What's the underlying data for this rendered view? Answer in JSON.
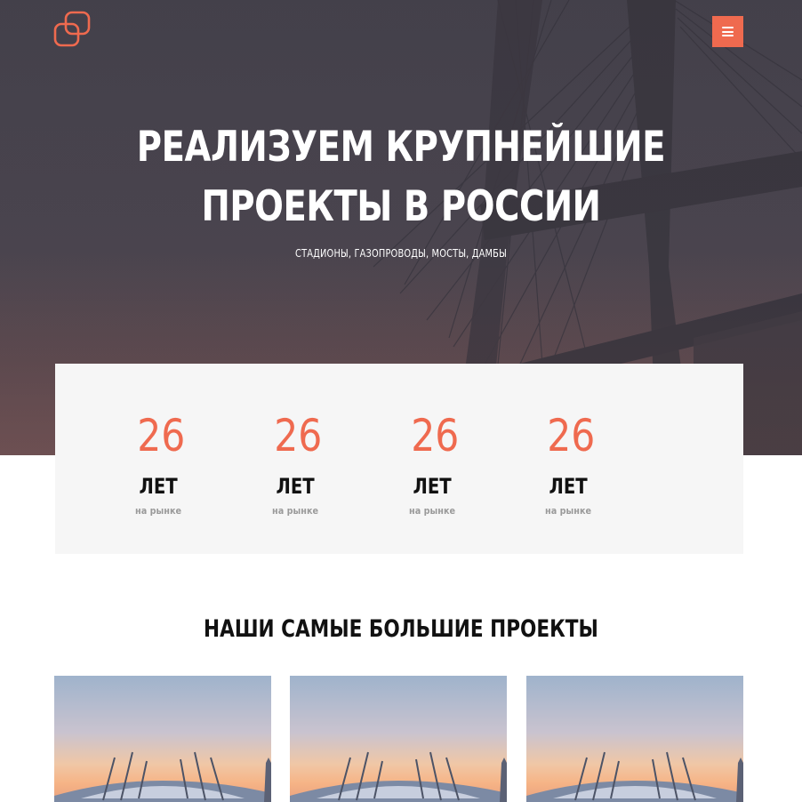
{
  "header": {
    "logo_icon": "linked-squares-logo-icon",
    "menu_icon": "hamburger-menu-icon",
    "accent_color": "#ef6a4f"
  },
  "hero": {
    "title_line1": "РЕАЛИЗУЕМ КРУПНЕЙШИЕ",
    "title_line2": "ПРОЕКТЫ В РОССИИ",
    "subtitle": "СТАДИОНЫ, ГАЗОПРОВОДЫ, МОСТЫ, ДАМБЫ"
  },
  "stats": [
    {
      "number": "26",
      "label": "ЛЕТ",
      "caption": "на рынке"
    },
    {
      "number": "26",
      "label": "ЛЕТ",
      "caption": "на рынке"
    },
    {
      "number": "26",
      "label": "ЛЕТ",
      "caption": "на рынке"
    },
    {
      "number": "26",
      "label": "ЛЕТ",
      "caption": "на рынке"
    }
  ],
  "projects": {
    "title": "НАШИ САМЫЕ БОЛЬШИЕ ПРОЕКТЫ",
    "cards": [
      {
        "image": "stadium-sunset-photo"
      },
      {
        "image": "stadium-sunset-photo"
      },
      {
        "image": "stadium-sunset-photo"
      }
    ]
  }
}
